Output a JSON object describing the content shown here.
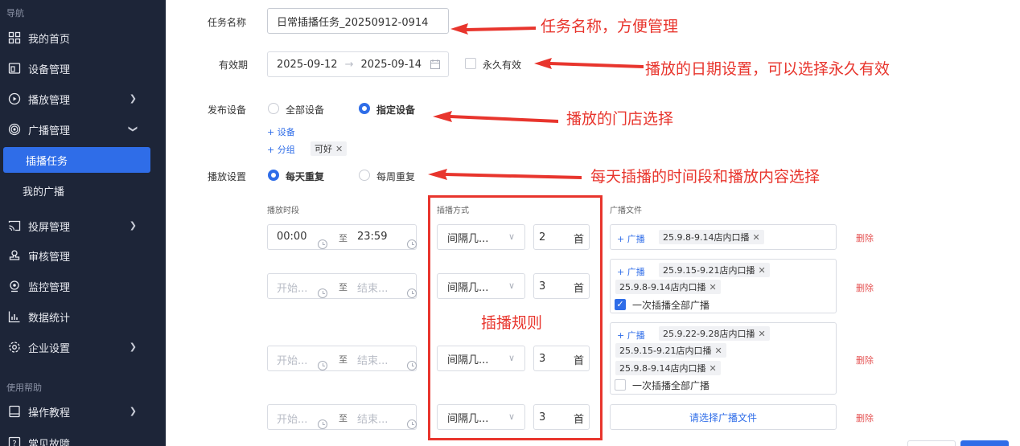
{
  "sidebar": {
    "group_nav": "导航",
    "group_help": "使用帮助",
    "items": [
      {
        "label": "我的首页"
      },
      {
        "label": "设备管理"
      },
      {
        "label": "播放管理"
      },
      {
        "label": "广播管理"
      },
      {
        "label": "插播任务"
      },
      {
        "label": "我的广播"
      },
      {
        "label": "投屏管理"
      },
      {
        "label": "审核管理"
      },
      {
        "label": "监控管理"
      },
      {
        "label": "数据统计"
      },
      {
        "label": "企业设置"
      },
      {
        "label": "操作教程"
      },
      {
        "label": "常见故障"
      }
    ]
  },
  "form": {
    "task_name_label": "任务名称",
    "task_name_value": "日常插播任务_20250912-0914",
    "validity_label": "有效期",
    "date_start": "2025-09-12",
    "date_sep": "→",
    "date_end": "2025-09-14",
    "permanent_label": "永久有效",
    "device_label": "发布设备",
    "device_all": "全部设备",
    "device_specified": "指定设备",
    "add_device": "+  设备",
    "add_group": "+  分组",
    "group_tag": "可好",
    "play_setting_label": "播放设置",
    "repeat_daily": "每天重复",
    "repeat_weekly": "每周重复"
  },
  "schedule": {
    "col_time": "播放时段",
    "col_mode": "插播方式",
    "col_files": "广播文件",
    "to": "至",
    "add_broadcast": "+  广播",
    "play_all_label": "一次插播全部广播",
    "select_file_placeholder": "请选择广播文件",
    "delete_label": "删除",
    "rows": [
      {
        "start": "00:00",
        "end": "23:59",
        "mode": "间隔几...",
        "count": "2",
        "unit": "首",
        "files": [
          "25.9.8-9.14店内口播"
        ]
      },
      {
        "start": "开始...",
        "end": "结束...",
        "mode": "间隔几...",
        "count": "3",
        "unit": "首",
        "files": [
          "25.9.15-9.21店内口播",
          "25.9.8-9.14店内口播"
        ]
      },
      {
        "start": "开始...",
        "end": "结束...",
        "mode": "间隔几...",
        "count": "3",
        "unit": "首",
        "files": [
          "25.9.22-9.28店内口播",
          "25.9.15-9.21店内口播",
          "25.9.8-9.14店内口播"
        ]
      },
      {
        "start": "开始...",
        "end": "结束...",
        "mode": "间隔几...",
        "count": "3",
        "unit": "首",
        "files": []
      }
    ]
  },
  "annotations": {
    "task_name": "任务名称，方便管理",
    "date": "播放的日期设置，可以选择永久有效",
    "store": "播放的门店选择",
    "time": "每天插播的时间段和播放内容选择",
    "rule": "插播规则"
  },
  "colors": {
    "accent": "#2f6de8",
    "sidebar_bg": "#1d2538",
    "annotation_red": "#e8352d",
    "delete_red": "#e55353"
  }
}
